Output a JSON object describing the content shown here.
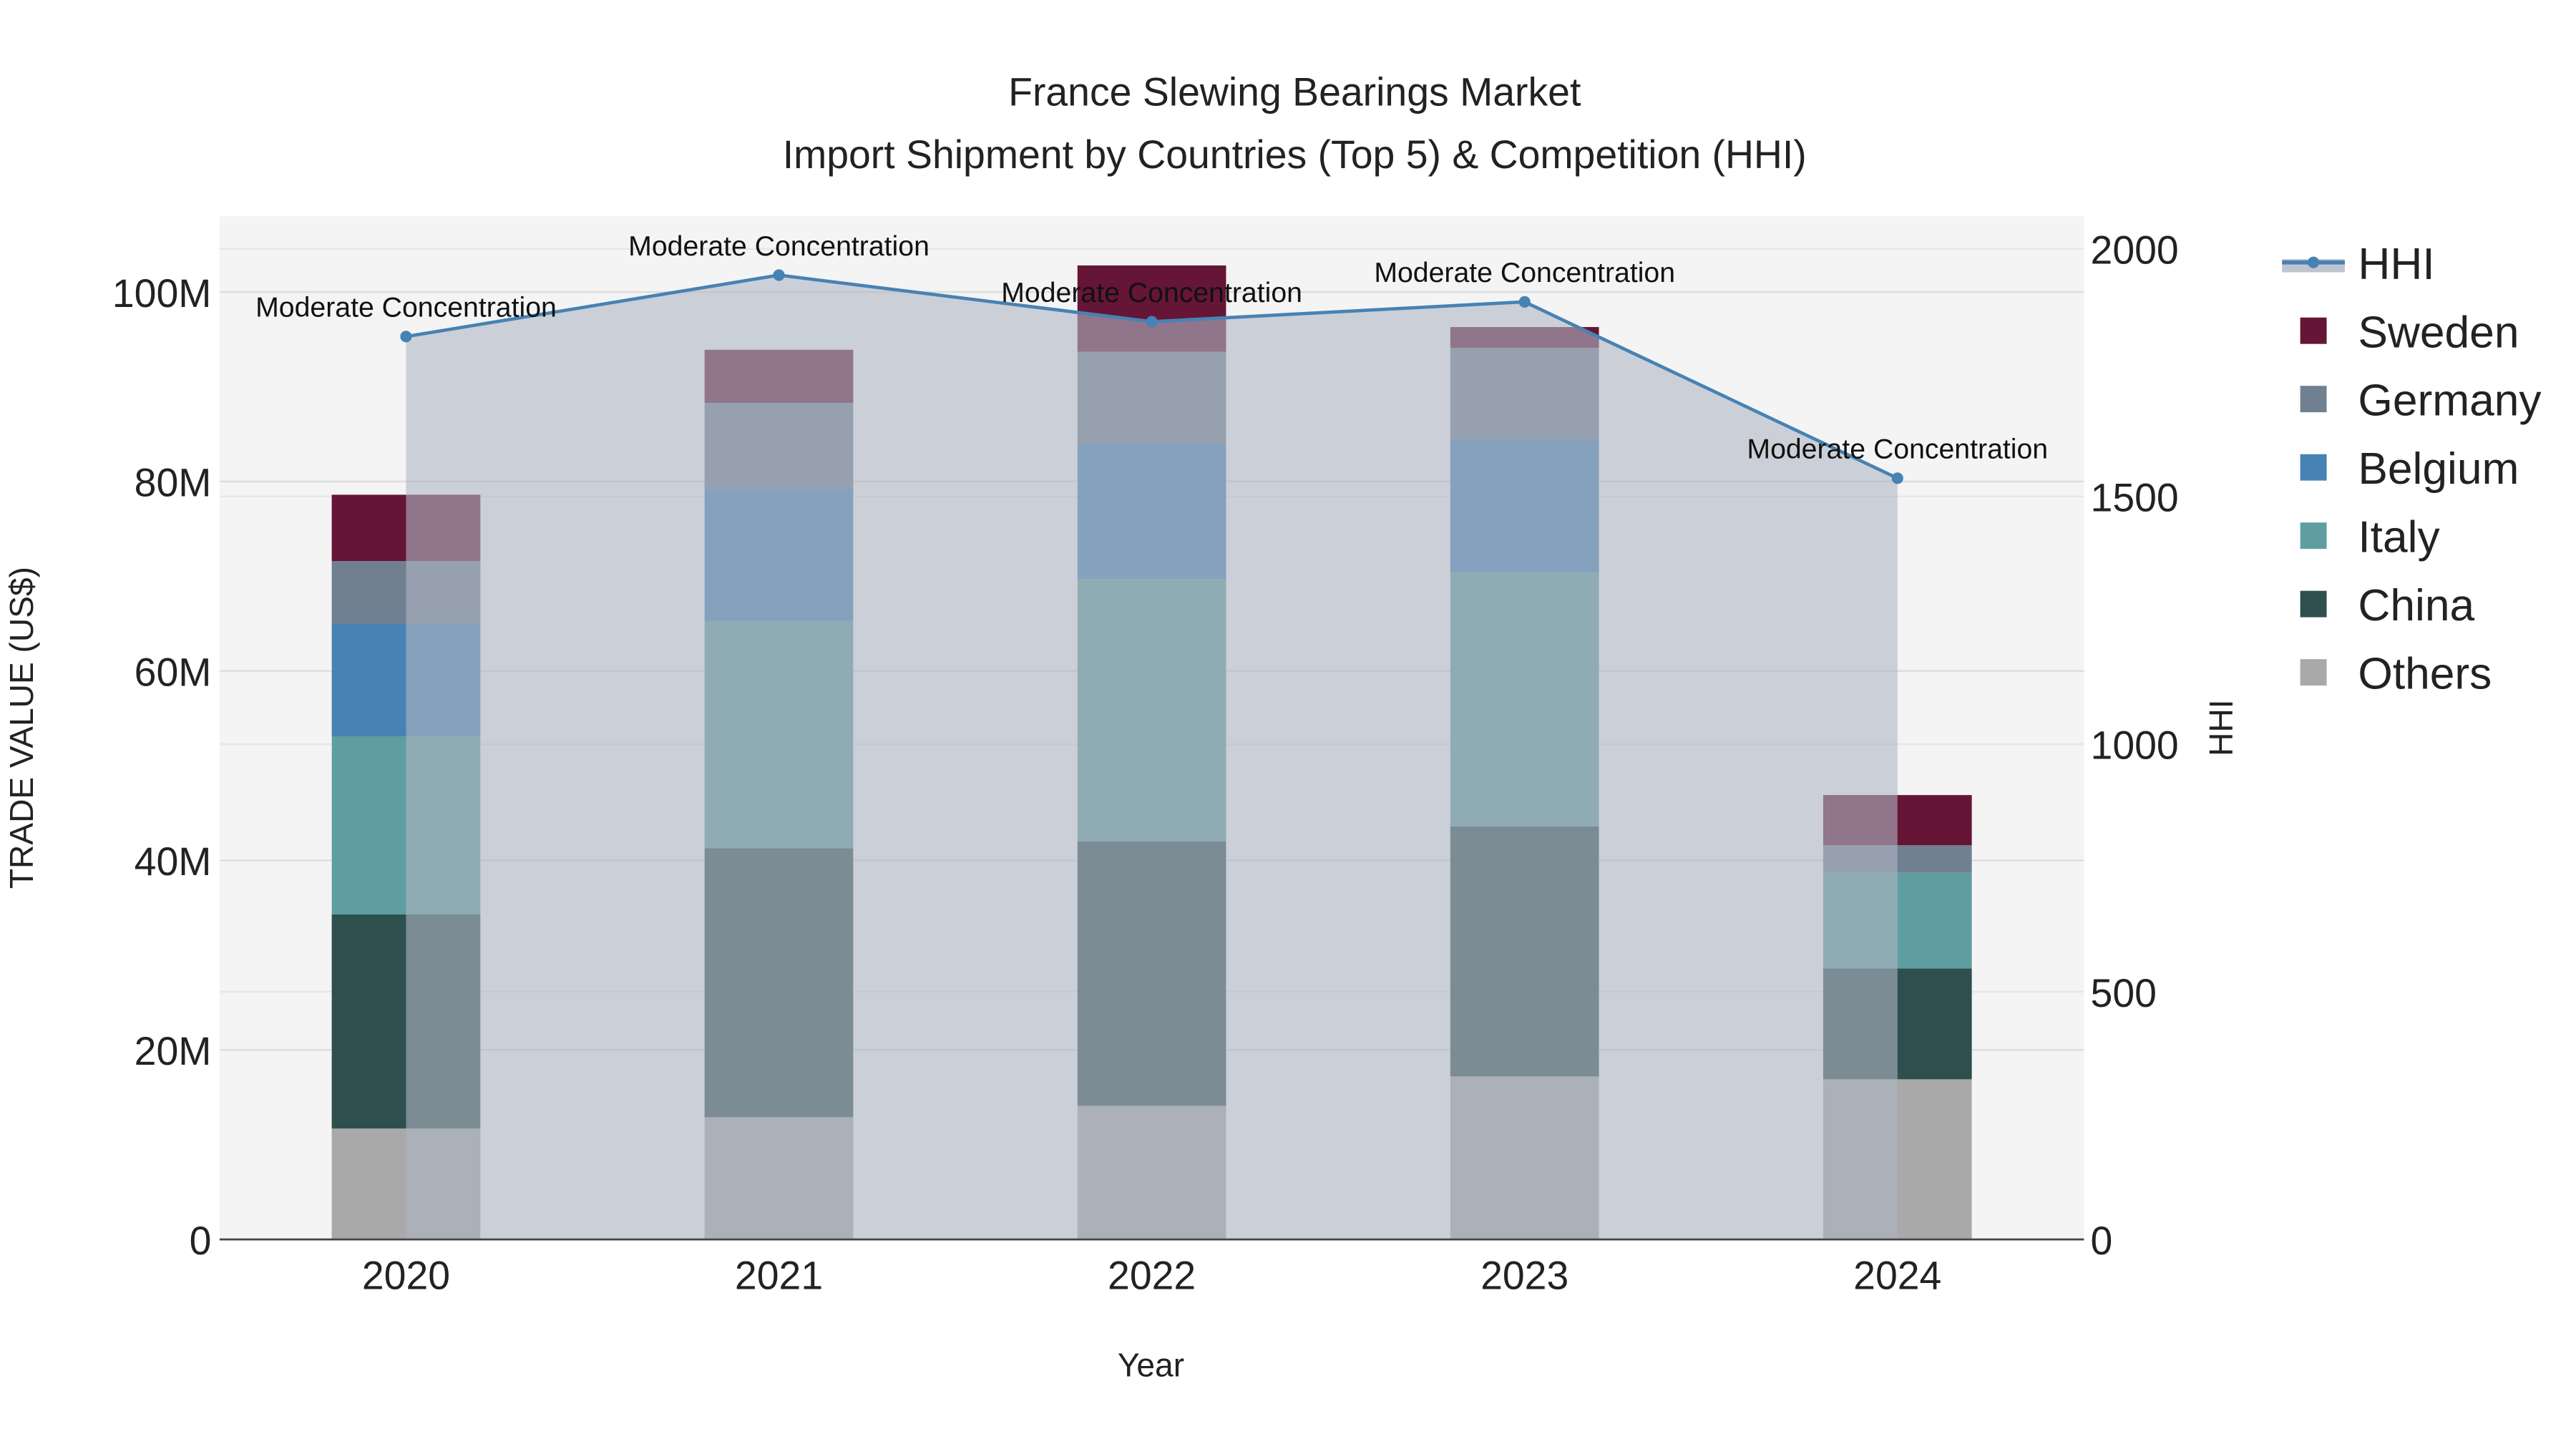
{
  "chart_data": {
    "type": "bar",
    "title": "France Slewing Bearings Market",
    "subtitle": "Import Shipment by Countries (Top 5) & Competition (HHI)",
    "xlabel": "Year",
    "ylabel": "TRADE VALUE (US$)",
    "y2label": "HHI",
    "categories": [
      "2020",
      "2021",
      "2022",
      "2023",
      "2024"
    ],
    "ylim": [
      0,
      108
    ],
    "yticks": [
      0,
      20,
      40,
      60,
      80,
      100
    ],
    "ytick_labels": [
      "0",
      "20M",
      "40M",
      "60M",
      "80M",
      "100M"
    ],
    "y2lim": [
      0,
      2066
    ],
    "y2ticks": [
      0,
      500,
      1000,
      1500,
      2000
    ],
    "y2tick_labels": [
      "0",
      "500",
      "1000",
      "1500",
      "2000"
    ],
    "units": "million US$",
    "series": [
      {
        "name": "Others",
        "color": "#a9a9a9",
        "values": [
          11.7,
          12.9,
          14.1,
          17.2,
          16.9
        ]
      },
      {
        "name": "China",
        "color": "#2f4f4f",
        "values": [
          22.6,
          28.4,
          27.9,
          26.4,
          11.7
        ]
      },
      {
        "name": "Italy",
        "color": "#5f9ea0",
        "values": [
          18.8,
          24.0,
          27.7,
          26.8,
          10.1
        ]
      },
      {
        "name": "Belgium",
        "color": "#4682b4",
        "values": [
          11.9,
          14.0,
          14.3,
          14.1,
          0.0
        ]
      },
      {
        "name": "Germany",
        "color": "#708090",
        "values": [
          6.6,
          9.0,
          9.7,
          9.6,
          2.9
        ]
      },
      {
        "name": "Sweden",
        "color": "#651536",
        "values": [
          7.0,
          5.6,
          9.1,
          2.2,
          5.3
        ]
      }
    ],
    "hhi": {
      "name": "HHI",
      "color": "#4682b4",
      "values": [
        1823,
        1947,
        1853,
        1893,
        1537
      ],
      "annotations": [
        "Moderate Concentration",
        "Moderate Concentration",
        "Moderate Concentration",
        "Moderate Concentration",
        "Moderate Concentration"
      ]
    },
    "legend": {
      "placement": "right",
      "order": [
        "HHI",
        "Sweden",
        "Germany",
        "Belgium",
        "Italy",
        "China",
        "Others"
      ]
    },
    "grid": true
  }
}
